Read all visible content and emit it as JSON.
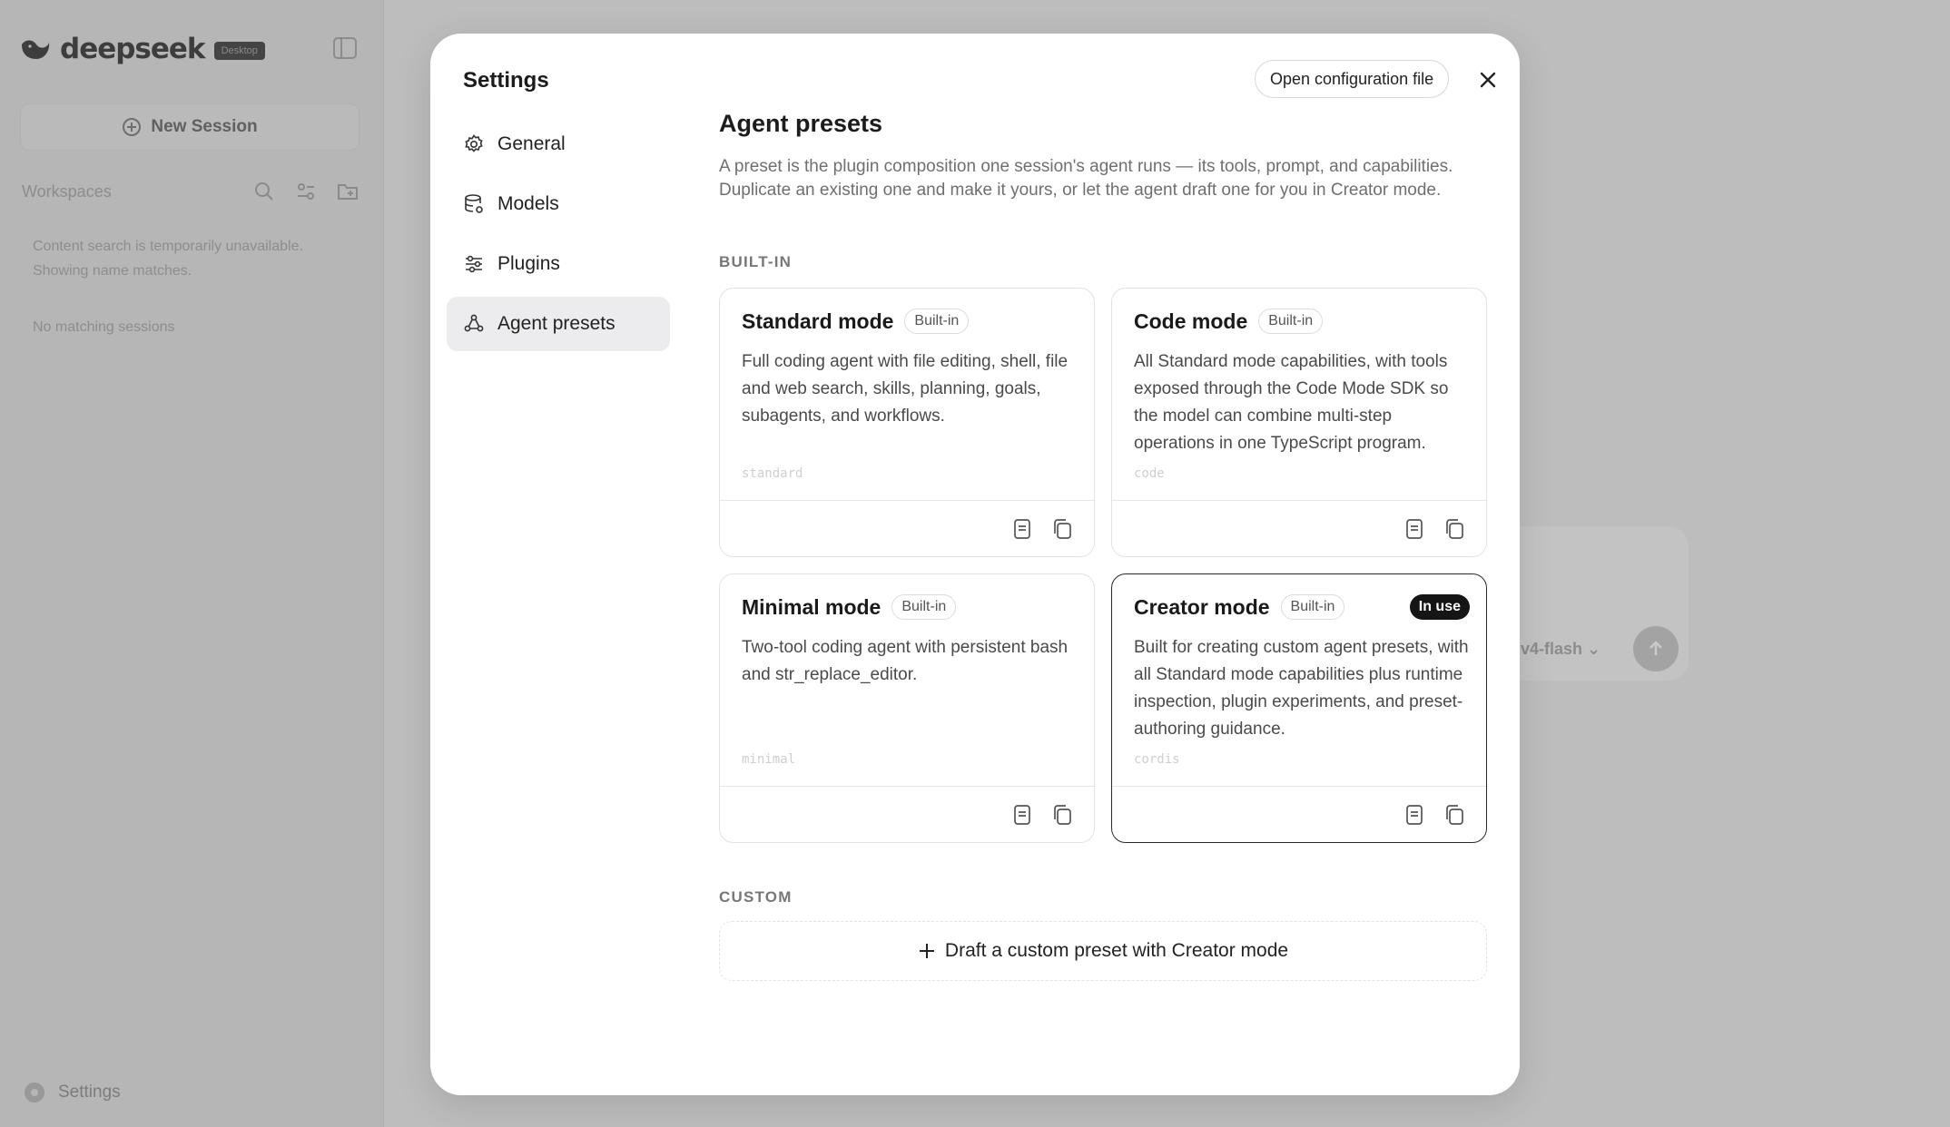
{
  "app": {
    "logo_text": "deepseek",
    "logo_badge": "Desktop",
    "new_session_label": "New Session",
    "workspaces_label": "Workspaces",
    "search_note": "Content search is temporarily unavailable. Showing name matches.",
    "empty_note": "No matching sessions",
    "settings_label": "Settings",
    "composer_model": "v4-flash"
  },
  "modal": {
    "title": "Settings",
    "open_config_label": "Open configuration file",
    "nav": [
      {
        "label": "General",
        "icon": "gear-icon"
      },
      {
        "label": "Models",
        "icon": "database-icon"
      },
      {
        "label": "Plugins",
        "icon": "sliders-icon"
      },
      {
        "label": "Agent presets",
        "icon": "nodes-icon",
        "active": true
      }
    ]
  },
  "presets": {
    "title": "Agent presets",
    "description": "A preset is the plugin composition one session's agent runs — its tools, prompt, and capabilities. Duplicate an existing one and make it yours, or let the agent draft one for you in Creator mode.",
    "builtin_label": "BUILT-IN",
    "custom_label": "CUSTOM",
    "builtin_tag": "Built-in",
    "in_use_label": "In use",
    "cards": [
      {
        "name": "Standard mode",
        "desc": "Full coding agent with file editing, shell, file and web search, skills, planning, goals, subagents, and workflows.",
        "id": "standard",
        "in_use": false
      },
      {
        "name": "Code mode",
        "desc": "All Standard mode capabilities, with tools exposed through the Code Mode SDK so the model can combine multi-step operations in one TypeScript program.",
        "id": "code",
        "in_use": false
      },
      {
        "name": "Minimal mode",
        "desc": "Two-tool coding agent with persistent bash and str_replace_editor.",
        "id": "minimal",
        "in_use": false
      },
      {
        "name": "Creator mode",
        "desc": "Built for creating custom agent presets, with all Standard mode capabilities plus runtime inspection, plugin experiments, and preset-authoring guidance.",
        "id": "cordis",
        "in_use": true
      }
    ],
    "draft_label": "Draft a custom preset with Creator mode"
  },
  "colors": {
    "overlay_bg": "#c6c6c6",
    "modal_bg": "#ffffff",
    "active_nav": "#ececee",
    "in_use_badge": "#151515"
  }
}
